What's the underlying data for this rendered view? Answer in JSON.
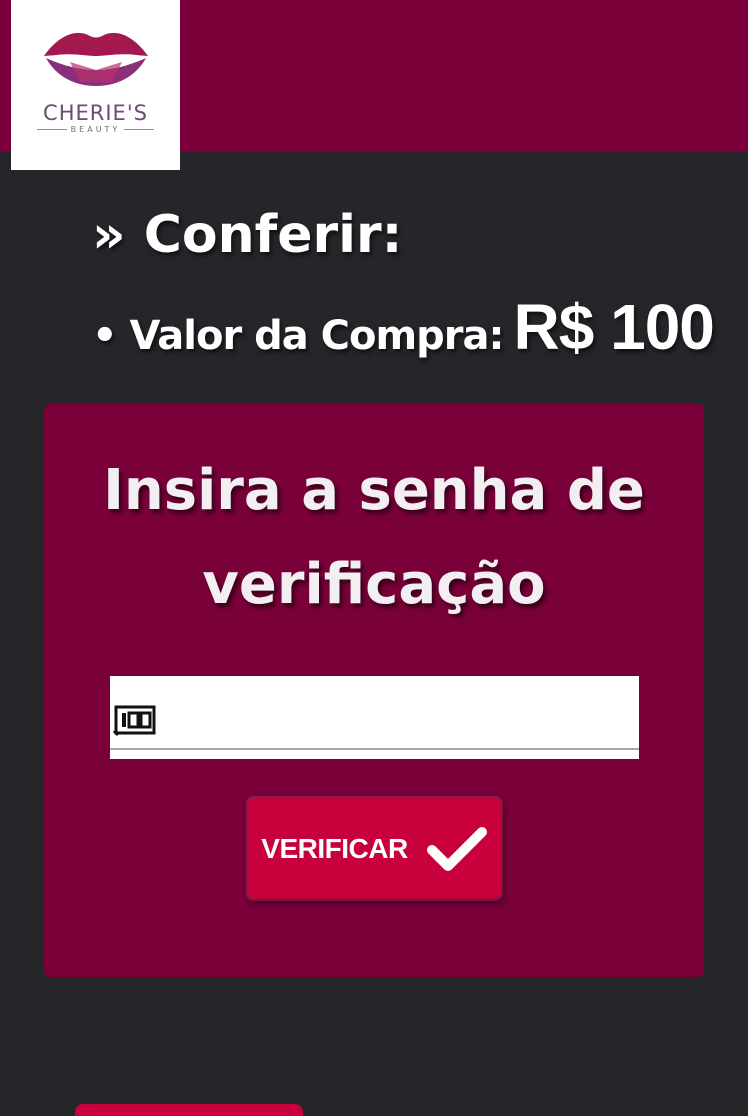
{
  "header": {
    "brand_name": "CHERIE'S",
    "brand_subtitle": "BEAUTY",
    "accent_color": "#7a003a",
    "logo_icon": "lips-logo-icon"
  },
  "summary": {
    "heading": "» Conferir:",
    "purchase_label": "• Valor da Compra:",
    "purchase_amount": "R$ 100"
  },
  "verification_card": {
    "title": "Insira a senha de verificação",
    "input_value": "",
    "input_icon": "keypad-100-icon",
    "button_label": "VERIFICAR",
    "button_icon": "checkmark-icon",
    "button_color": "#c8003b"
  }
}
